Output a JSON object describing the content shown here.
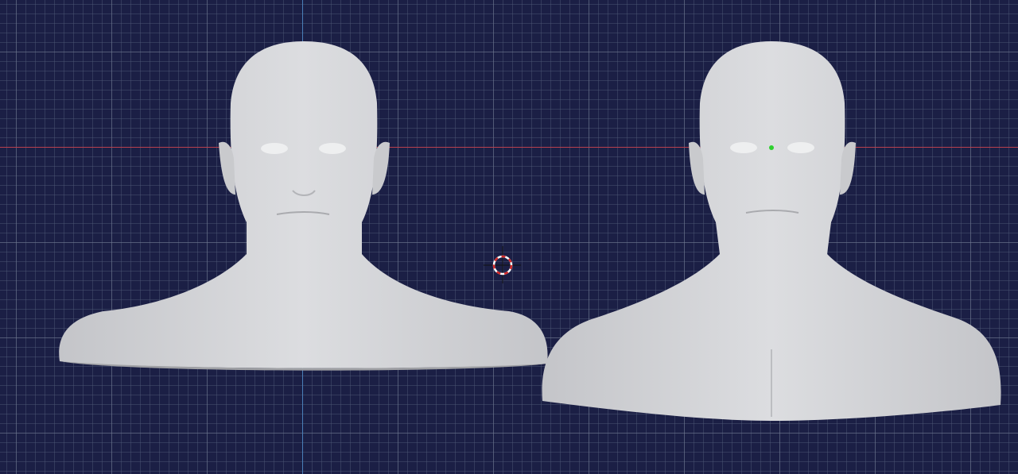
{
  "viewport": {
    "background_color": "#1b1f45",
    "x_axis_color": "#b8404e",
    "y_axis_color": "#4a7fb8",
    "mesh_color": "#d2d3d6",
    "objects": [
      {
        "name": "bust-left",
        "selected": false
      },
      {
        "name": "bust-right",
        "selected": true,
        "origin_color": "#2fd02f"
      }
    ],
    "cursor_icon": "3d-cursor-icon"
  }
}
